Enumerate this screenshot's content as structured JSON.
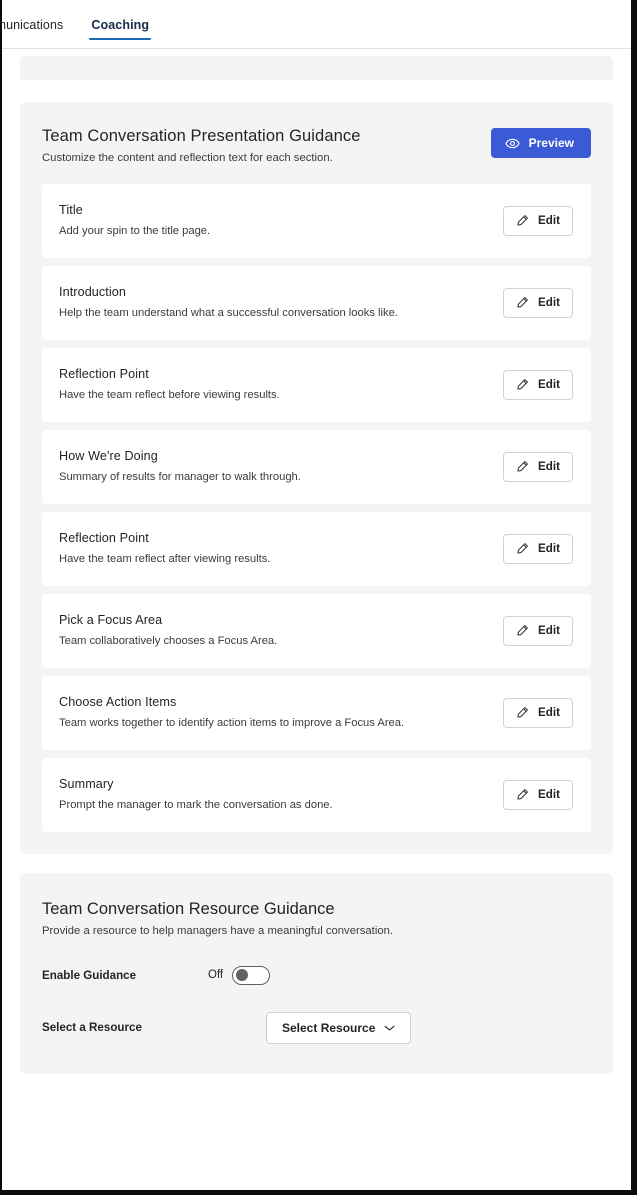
{
  "tabs": [
    {
      "label": "ommunications",
      "active": false,
      "clipped": true
    },
    {
      "label": "Coaching",
      "active": true,
      "clipped": false
    }
  ],
  "presentation": {
    "title": "Team Conversation Presentation Guidance",
    "subtitle": "Customize the content and reflection text for each section.",
    "preview_label": "Preview",
    "preview_icon": "eye-icon",
    "accent_color": "#3b5ad6",
    "edit_label": "Edit",
    "edit_icon": "pencil-icon",
    "sections": [
      {
        "title": "Title",
        "desc": "Add your spin to the title page."
      },
      {
        "title": "Introduction",
        "desc": "Help the team understand what a successful conversation looks like."
      },
      {
        "title": "Reflection Point",
        "desc": "Have the team reflect before viewing results."
      },
      {
        "title": "How We're Doing",
        "desc": "Summary of results for manager to walk through."
      },
      {
        "title": "Reflection Point",
        "desc": "Have the team reflect after viewing results."
      },
      {
        "title": "Pick a Focus Area",
        "desc": "Team collaboratively chooses a Focus Area."
      },
      {
        "title": "Choose Action Items",
        "desc": "Team works together to identify action items to improve a Focus Area."
      },
      {
        "title": "Summary",
        "desc": "Prompt the manager to mark the conversation as done."
      }
    ]
  },
  "resource": {
    "title": "Team Conversation Resource Guidance",
    "subtitle": "Provide a resource to help managers have a meaningful conversation.",
    "enable_label": "Enable Guidance",
    "toggle_state": "Off",
    "toggle_on": false,
    "select_label": "Select a Resource",
    "select_value": "Select Resource",
    "select_icon": "chevron-down-icon"
  }
}
